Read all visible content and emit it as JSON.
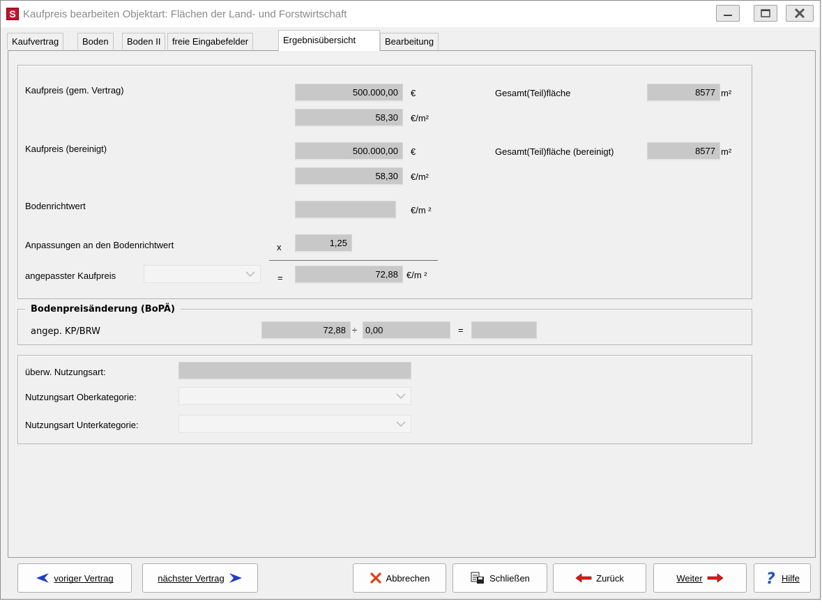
{
  "window": {
    "icon_letter": "S",
    "title": "Kaufpreis bearbeiten  Objektart: Flächen der Land- und Forstwirtschaft"
  },
  "tabs": [
    {
      "label": "Kaufvertrag"
    },
    {
      "label": "Boden"
    },
    {
      "label": "Boden II"
    },
    {
      "label": "freie Eingabefelder"
    },
    {
      "label": "Ergebnisübersicht"
    },
    {
      "label": "Bearbeitung"
    }
  ],
  "kaufpreis": {
    "vertrag_label": "Kaufpreis (gem. Vertrag)",
    "vertrag_value": "500.000,00",
    "vertrag_unit": "€",
    "vertrag_qm_value": "58,30",
    "vertrag_qm_unit": "€/m²",
    "bereinigt_label": "Kaufpreis (bereinigt)",
    "bereinigt_value": "500.000,00",
    "bereinigt_unit": "€",
    "bereinigt_qm_value": "58,30",
    "bereinigt_qm_unit": "€/m²",
    "gesamt_label": "Gesamt(Teil)fläche",
    "gesamt_value": "8577",
    "gesamt_unit": "m²",
    "gesamt_ber_label": "Gesamt(Teil)fläche (bereinigt)",
    "gesamt_ber_value": "8577",
    "gesamt_ber_unit": "m²",
    "brw_label": "Bodenrichtwert",
    "brw_value": "",
    "brw_unit": "€/m ²",
    "anpassung_label": "Anpassungen an den Bodenrichtwert",
    "anpassung_op": "x",
    "anpassung_value": "1,25",
    "angepasst_label": "angepasster Kaufpreis",
    "angepasst_combo": "",
    "angepasst_op": "=",
    "angepasst_value": "72,88",
    "angepasst_unit": "€/m ²"
  },
  "bopae": {
    "title": "Bodenpreisänderung (BoPÄ)",
    "row_label": "angep. KP/BRW",
    "value1": "72,88",
    "div_op": "÷",
    "value2": "0,00",
    "eq_op": "=",
    "result": ""
  },
  "nutzung": {
    "ueberw_label": "überw. Nutzungsart:",
    "ueberw_value": "",
    "ober_label": "Nutzungsart Oberkategorie:",
    "ober_value": "",
    "unter_label": "Nutzungsart Unterkategorie:",
    "unter_value": ""
  },
  "buttons": {
    "prev": "voriger Vertrag",
    "next": "nächster Vertrag",
    "cancel": "Abbrechen",
    "close": "Schließen",
    "back": "Zurück",
    "forward": "Weiter",
    "help": "Hilfe"
  },
  "colors": {
    "arrow_blue": "#1e3cc8",
    "arrow_red": "#e01818",
    "cancel_x": "#e0401a",
    "help_blue": "#1e50c8"
  }
}
